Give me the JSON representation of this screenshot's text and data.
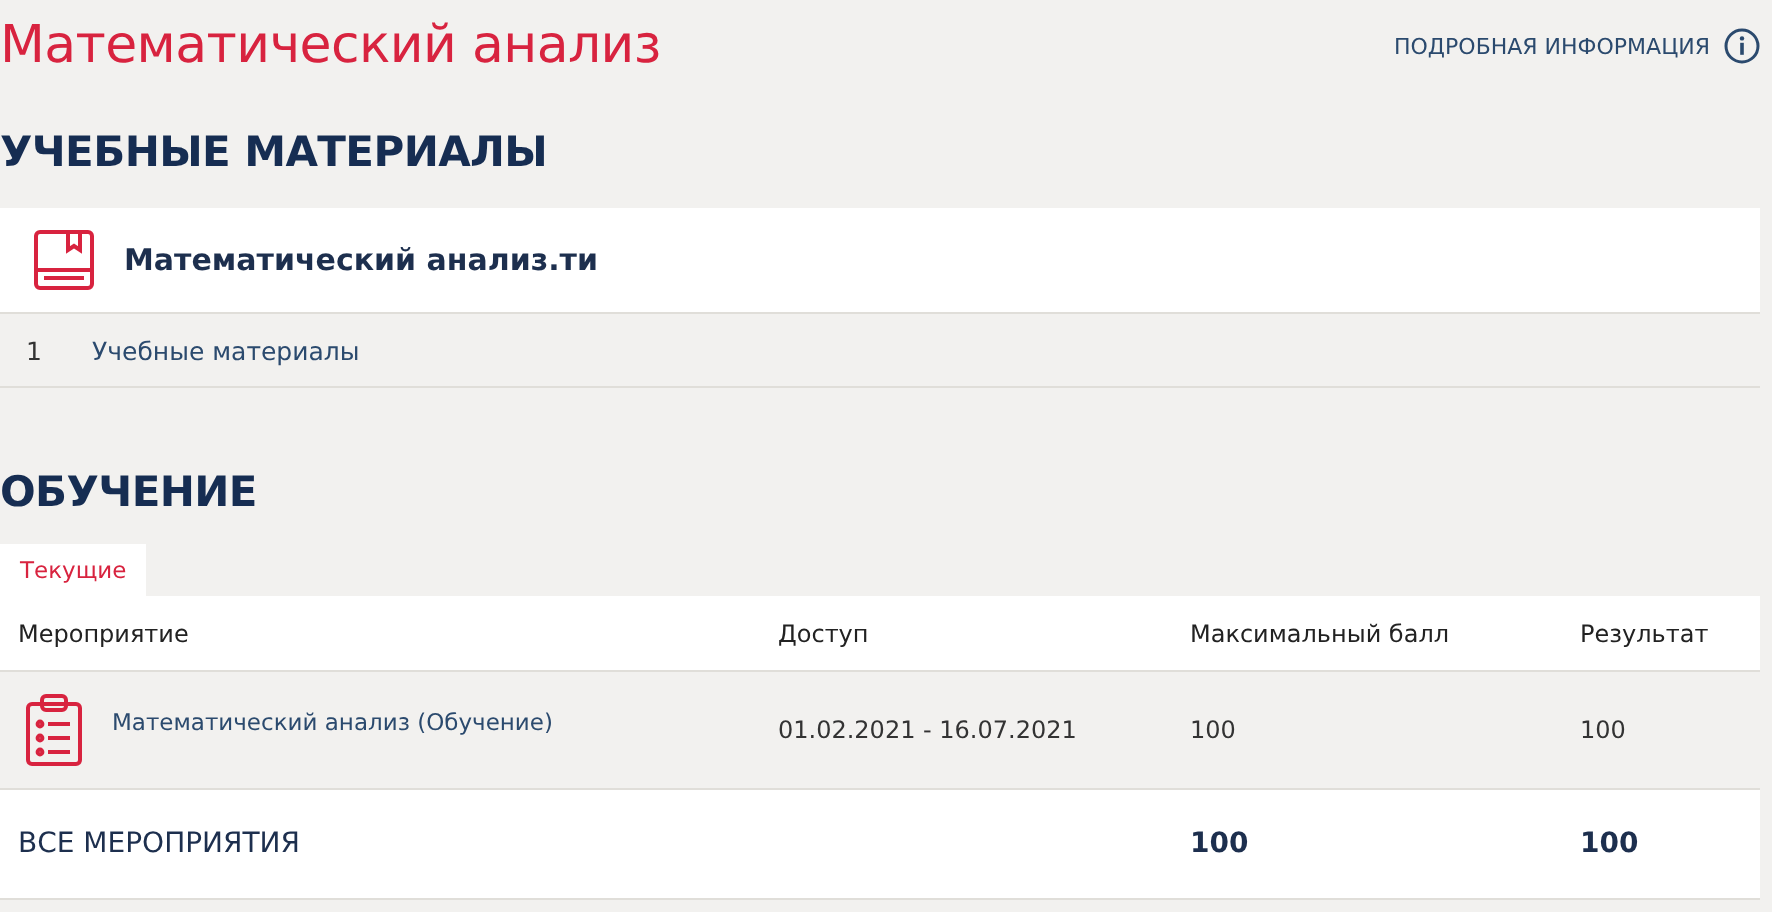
{
  "title": "Математический анализ",
  "info_link": "ПОДРОБНАЯ ИНФОРМАЦИЯ",
  "materials": {
    "heading": "УЧЕБНЫЕ МАТЕРИАЛЫ",
    "card_title": "Математический анализ.ти",
    "items": [
      {
        "number": "1",
        "label": "Учебные материалы"
      }
    ]
  },
  "training": {
    "heading": "ОБУЧЕНИЕ",
    "tabs": [
      {
        "label": "Текущие",
        "selected": true
      }
    ],
    "table": {
      "columns": [
        "Мероприятие",
        "Доступ",
        "Максимальный балл",
        "Результат"
      ],
      "rows": [
        {
          "event": "Математический анализ (Обучение)",
          "access": "01.02.2021 - 16.07.2021",
          "max_score": "100",
          "result": "100"
        }
      ],
      "total": {
        "label": "ВСЕ МЕРОПРИЯТИЯ",
        "max_score": "100",
        "result": "100"
      }
    }
  }
}
